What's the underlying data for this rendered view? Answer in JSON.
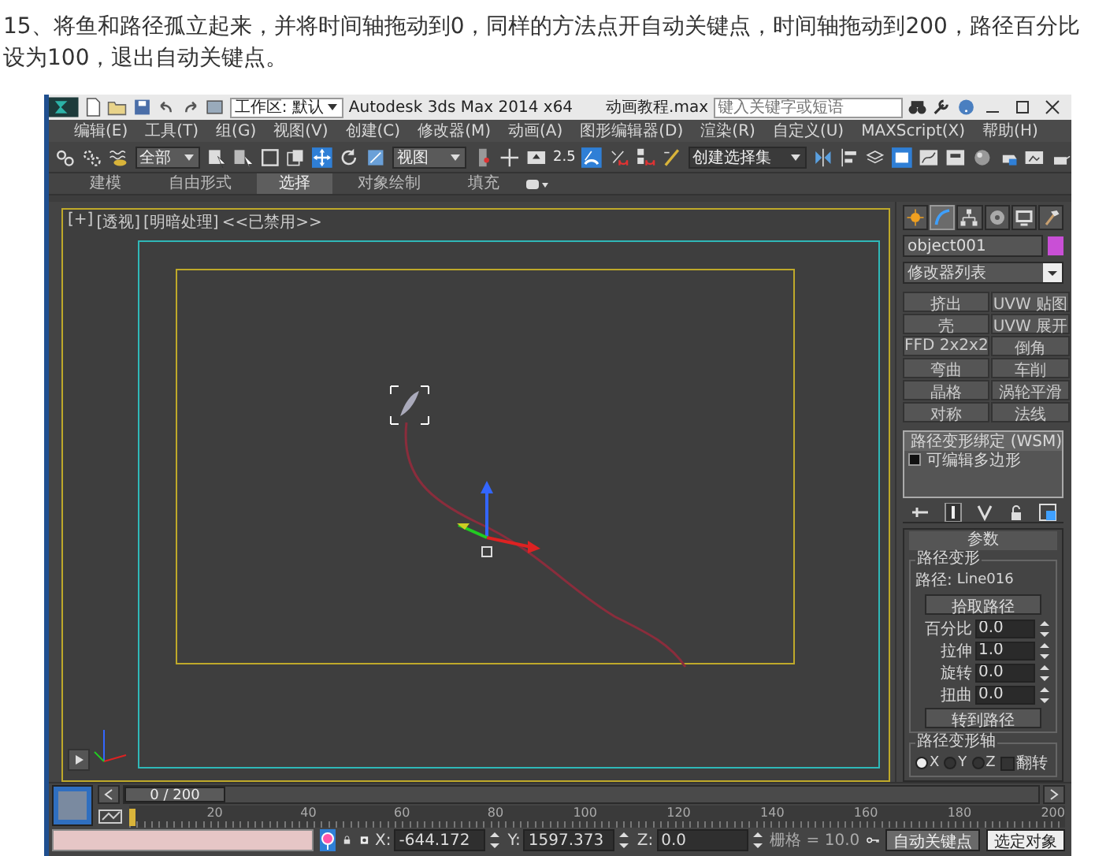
{
  "instruction": "15、将鱼和路径孤立起来，并将时间轴拖动到0，同样的方法点开自动关键点，时间轴拖动到200，路径百分比设为100，退出自动关键点。",
  "app": {
    "title_bar": {
      "workspace": "工作区: 默认",
      "title": "Autodesk 3ds Max  2014 x64",
      "file": "动画教程.max",
      "search": {
        "placeholder": "键入关键字或短语"
      }
    },
    "menu": [
      "编辑(E)",
      "工具(T)",
      "组(G)",
      "视图(V)",
      "创建(C)",
      "修改器(M)",
      "动画(A)",
      "图形编辑器(D)",
      "渲染(R)",
      "自定义(U)",
      "MAXScript(X)",
      "帮助(H)"
    ],
    "toolbar": {
      "selection_filter": "全部",
      "reference_coord": "视图",
      "snap": "2.5",
      "named_selection": "创建选择集"
    },
    "ribbon_tabs": [
      {
        "label": "建模",
        "selected": false
      },
      {
        "label": "自由形式",
        "selected": false
      },
      {
        "label": "选择",
        "selected": true
      },
      {
        "label": "对象绘制",
        "selected": false
      },
      {
        "label": "填充",
        "selected": false
      }
    ],
    "viewport": {
      "labels": [
        "[+]",
        "[透视]",
        "[明暗处理]",
        "<<已禁用>>"
      ]
    },
    "command_panel": {
      "tabs": [
        {
          "kind": "create",
          "selected": false
        },
        {
          "kind": "modify",
          "selected": true
        },
        {
          "kind": "hierarchy",
          "selected": false
        },
        {
          "kind": "motion",
          "selected": false
        },
        {
          "kind": "display",
          "selected": false
        },
        {
          "kind": "utilities",
          "selected": false
        }
      ],
      "object_name": "object001",
      "modifier_list": "修改器列表",
      "modifier_buttons": [
        "挤出",
        "UVW 贴图",
        "壳",
        "UVW 展开",
        "FFD 2x2x2",
        "倒角",
        "弯曲",
        "车削",
        "晶格",
        "涡轮平滑",
        "对称",
        "法线"
      ],
      "stack": [
        {
          "kind": "modifier",
          "label": "路径变形绑定 (WSM)"
        },
        {
          "kind": "base",
          "label": "可编辑多边形"
        }
      ],
      "parameters": {
        "title": "参数",
        "group": "路径变形",
        "path_label": "路径:",
        "path_value": "Line016",
        "pick_button": "拾取路径",
        "spinners": [
          {
            "label": "百分比",
            "value": "0.0"
          },
          {
            "label": "拉伸",
            "value": "1.0"
          },
          {
            "label": "旋转",
            "value": "0.0"
          },
          {
            "label": "扭曲",
            "value": "0.0"
          }
        ],
        "goto_button": "转到路径",
        "axis_group": "路径变形轴",
        "axes": [
          {
            "label": "X",
            "selected": true
          },
          {
            "label": "Y",
            "selected": false
          },
          {
            "label": "Z",
            "selected": false
          }
        ],
        "flip": {
          "label": "翻转",
          "checked": false
        }
      }
    },
    "timeline": {
      "frame": "0 / 200",
      "level": 0,
      "ticks": [
        "20",
        "40",
        "60",
        "80",
        "100",
        "120",
        "140",
        "160",
        "180",
        "200"
      ]
    },
    "status_bar": {
      "coords": [
        {
          "label": "X:",
          "value": "-644.172"
        },
        {
          "label": "Y:",
          "value": "1597.373"
        },
        {
          "label": "Z:",
          "value": "0.0"
        }
      ],
      "grid": "栅格 = 10.0",
      "auto_key": "自动关键点",
      "key_filter": "选定对象"
    }
  }
}
